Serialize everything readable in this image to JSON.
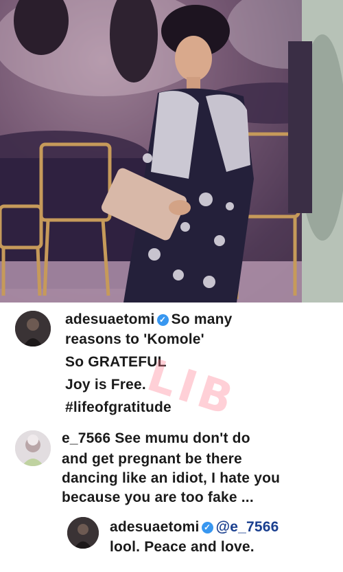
{
  "photo": {
    "alt": ""
  },
  "post": {
    "username": "adesuaetomi",
    "caption_lines": [
      "So many",
      "reasons to 'Komole'",
      "So GRATEFUL",
      "Joy is Free.",
      "#lifeofgratitude"
    ]
  },
  "comment": {
    "username": "e_7566",
    "text_lines": [
      "See mumu don't do",
      "and get pregnant be there",
      "dancing like an idiot, I hate you",
      "because you are too fake ..."
    ]
  },
  "reply": {
    "username": "adesuaetomi",
    "mention": "@e_7566",
    "text": "lool. Peace and love."
  },
  "watermark": {
    "text": "LIB"
  },
  "colors": {
    "verified": "#3897f0",
    "mention": "#1a3f8f",
    "watermark": "#ff788c"
  },
  "icons": {
    "verified": "verified-badge-icon"
  }
}
